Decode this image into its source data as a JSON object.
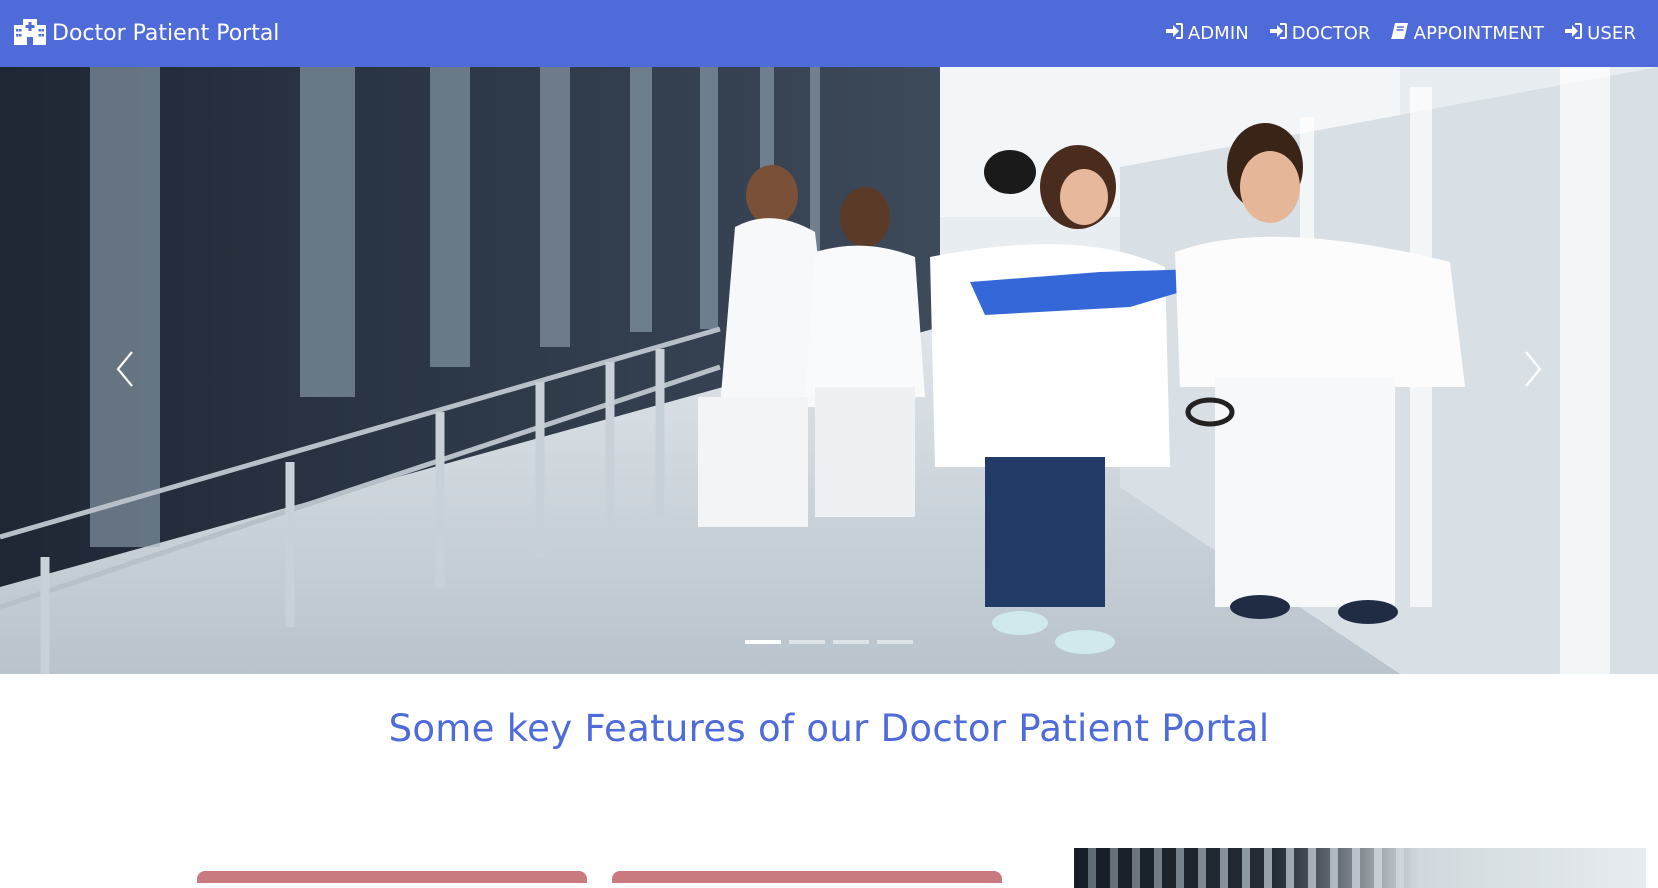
{
  "navbar": {
    "brand": "Doctor Patient Portal",
    "brand_icon": "hospital-icon",
    "links": [
      {
        "label": "ADMIN",
        "icon": "sign-in-icon"
      },
      {
        "label": "DOCTOR",
        "icon": "sign-in-icon"
      },
      {
        "label": "APPOINTMENT",
        "icon": "book-icon"
      },
      {
        "label": "USER",
        "icon": "sign-in-icon"
      }
    ]
  },
  "carousel": {
    "slide_count": 4,
    "active_index": 0,
    "prev_icon": "chevron-left-icon",
    "next_icon": "chevron-right-icon"
  },
  "features": {
    "title": "Some key Features of our Doctor Patient Portal"
  },
  "colors": {
    "primary": "#4e6bd9",
    "card_accent": "#c87a80"
  }
}
